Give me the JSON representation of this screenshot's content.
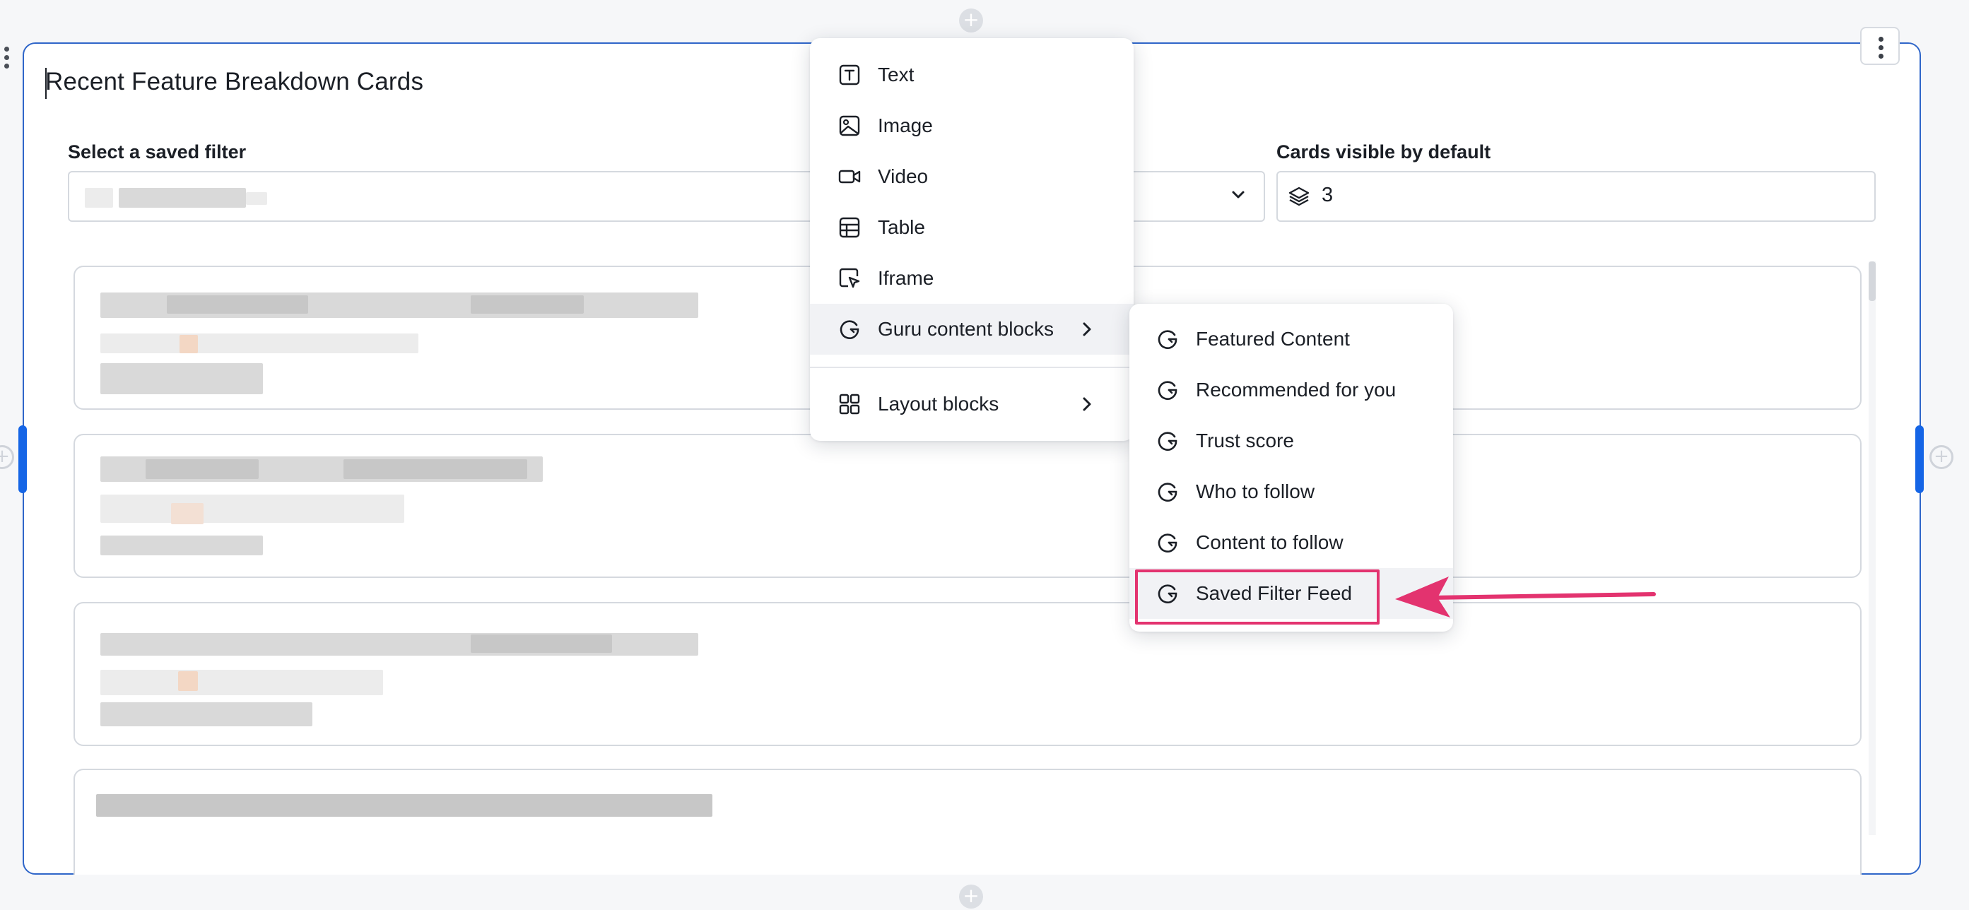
{
  "block": {
    "title": "Recent Feature Breakdown Cards",
    "filter_label": "Select a saved filter",
    "cards_label": "Cards visible by default",
    "cards_value": "3"
  },
  "insert_menu": {
    "items": [
      {
        "label": "Text",
        "icon": "text-icon"
      },
      {
        "label": "Image",
        "icon": "image-icon"
      },
      {
        "label": "Video",
        "icon": "video-icon"
      },
      {
        "label": "Table",
        "icon": "table-icon"
      },
      {
        "label": "Iframe",
        "icon": "iframe-icon"
      },
      {
        "label": "Guru content blocks",
        "icon": "guru-icon",
        "has_submenu": true
      },
      {
        "label": "Layout blocks",
        "icon": "layout-icon",
        "has_submenu": true
      }
    ]
  },
  "guru_submenu": {
    "items": [
      {
        "label": "Featured Content"
      },
      {
        "label": "Recommended for you"
      },
      {
        "label": "Trust score"
      },
      {
        "label": "Who to follow"
      },
      {
        "label": "Content to follow"
      },
      {
        "label": "Saved Filter Feed",
        "highlighted": true
      }
    ]
  },
  "colors": {
    "accent": "#2f66c9",
    "handle": "#1565e6",
    "annotation": "#e3336f"
  }
}
